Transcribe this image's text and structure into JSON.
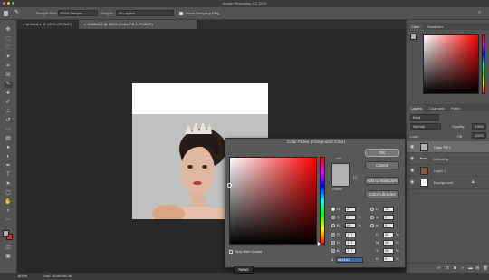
{
  "app": {
    "title": "Adobe Photoshop CC 2019"
  },
  "options": {
    "sample_size_label": "Sample Size:",
    "sample_size_value": "Point Sample",
    "sample_label": "Sample:",
    "sample_value": "All Layers",
    "show_ring_label": "Show Sampling Ring"
  },
  "tabs": [
    {
      "label": "Untitled-1 @ 100% (RGB/8*)"
    },
    {
      "label": "Untitled-2 @ 800% (Color Fill 1, RGB/8*)"
    }
  ],
  "status": {
    "zoom": "800%",
    "doc": "Doc: 30.9K/90.0K"
  },
  "color_panel": {
    "tabs": [
      "Color",
      "Swatches"
    ]
  },
  "layers_panel": {
    "tabs": [
      "Layers",
      "Channels",
      "Paths"
    ],
    "kind_label": "Kind",
    "blend_mode": "Normal",
    "opacity_label": "Opacity:",
    "opacity_value": "100%",
    "lock_label": "Lock:",
    "fill_label": "Fill:",
    "fill_value": "100%",
    "layers": [
      {
        "name": "Color Fill 1",
        "selected": true,
        "thumb": "#b1b1b1"
      },
      {
        "name": "colouring",
        "selected": false,
        "thumb": "#7a7a7a"
      },
      {
        "name": "Layer 1",
        "selected": false,
        "thumb": "#8a5a40"
      },
      {
        "name": "Background",
        "selected": false,
        "thumb": "#ffffff"
      }
    ]
  },
  "picker": {
    "title": "Color Picker (Foreground Color)",
    "new_label": "new",
    "current_label": "current",
    "new_color": "#b1b1b1",
    "current_color": "#b1b1b1",
    "ok_label": "OK",
    "cancel_label": "Cancel",
    "add_swatches_label": "Add to Swatches",
    "libraries_label": "Color Libraries",
    "only_web_label": "Only Web Colors",
    "hsb": [
      {
        "label": "H:",
        "value": "0",
        "unit": "°",
        "selected": true
      },
      {
        "label": "S:",
        "value": "0",
        "unit": "%",
        "selected": false
      },
      {
        "label": "B:",
        "value": "69",
        "unit": "%",
        "selected": false
      }
    ],
    "rgb": [
      {
        "label": "R:",
        "value": "177"
      },
      {
        "label": "G:",
        "value": "177"
      },
      {
        "label": "B:",
        "value": "177"
      }
    ],
    "lab": [
      {
        "label": "L:",
        "value": "72"
      },
      {
        "label": "a:",
        "value": "0"
      },
      {
        "label": "b:",
        "value": "0"
      }
    ],
    "cmyk": [
      {
        "label": "C:",
        "value": "32",
        "unit": "%"
      },
      {
        "label": "M:",
        "value": "25",
        "unit": "%"
      },
      {
        "label": "Y:",
        "value": "26",
        "unit": "%"
      },
      {
        "label": "K:",
        "value": "0",
        "unit": "%"
      }
    ],
    "hex_label": "#",
    "hex_value": "b1b1b1"
  },
  "tooltip": "News"
}
